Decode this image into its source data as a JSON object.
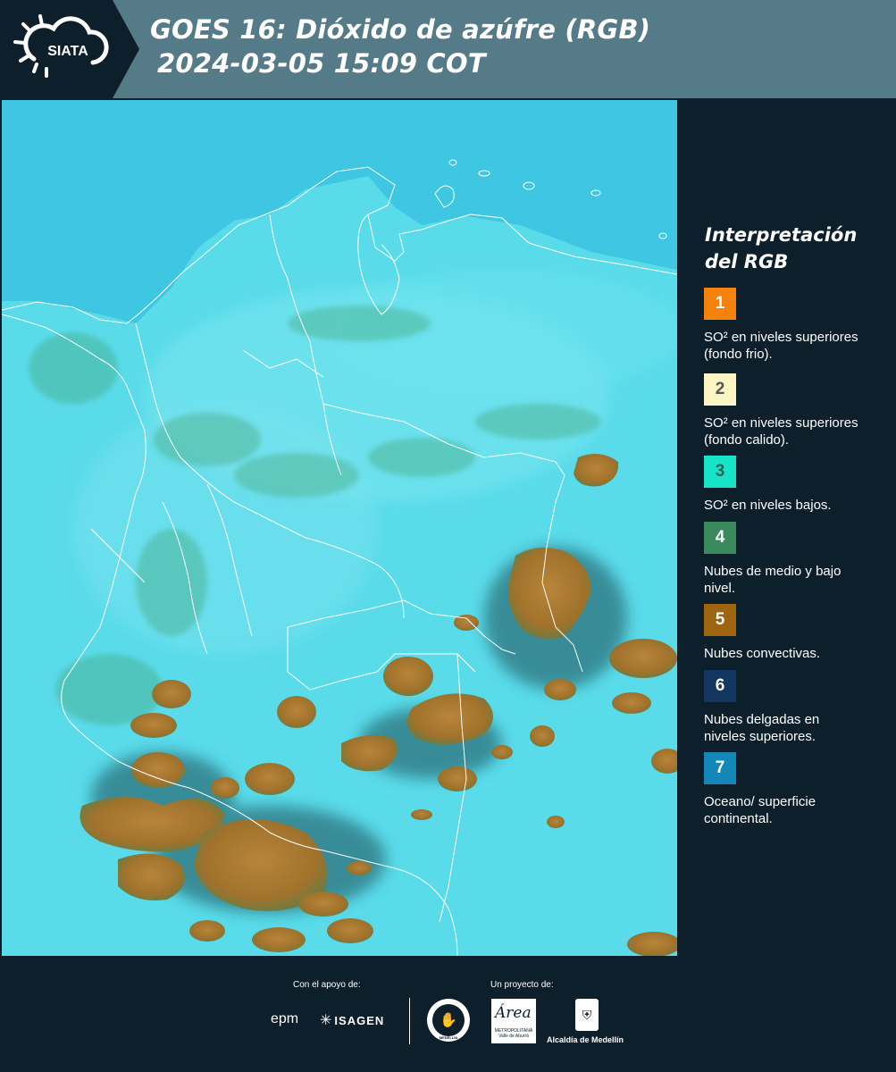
{
  "header": {
    "logo_text": "SIATA",
    "title_line1": "GOES 16: Dióxido de azúfre (RGB)",
    "title_line2": "2024-03-05 15:09 COT"
  },
  "legend": {
    "title": "Interpretación del RGB",
    "items": [
      {
        "number": "1",
        "color": "#f5820d",
        "text_color": "#ffffff",
        "label": "SO² en niveles superiores (fondo frio)."
      },
      {
        "number": "2",
        "color": "#fdf5c3",
        "text_color": "#555555",
        "label": "SO² en niveles superiores (fondo calido)."
      },
      {
        "number": "3",
        "color": "#17e3c8",
        "text_color": "#2c5f55",
        "label": "SO² en niveles bajos."
      },
      {
        "number": "4",
        "color": "#3a8a5e",
        "text_color": "#ffffff",
        "label": "Nubes de medio y bajo nivel."
      },
      {
        "number": "5",
        "color": "#9e6410",
        "text_color": "#ffffff",
        "label": "Nubes convectivas."
      },
      {
        "number": "6",
        "color": "#123660",
        "text_color": "#ffffff",
        "label": "Nubes delgadas en niveles superiores."
      },
      {
        "number": "7",
        "color": "#1388b8",
        "text_color": "#ffffff",
        "label": "Oceano/ superficie continental."
      }
    ]
  },
  "footer": {
    "support_label": "Con el apoyo de:",
    "project_label": "Un proyecto de:",
    "sponsors": [
      "epm",
      "ISAGEN"
    ],
    "project_partners": [
      "MEDELLÍN",
      "METROPOLITANA Valle de Aburrá",
      "Alcaldía de Medellín"
    ],
    "area_logo_text": "Área"
  },
  "map": {
    "ocean_color": "#3dc8e4",
    "land_color": "#5fe0ee",
    "cloud_color": "#a6782e",
    "border_color": "#ffffff"
  }
}
